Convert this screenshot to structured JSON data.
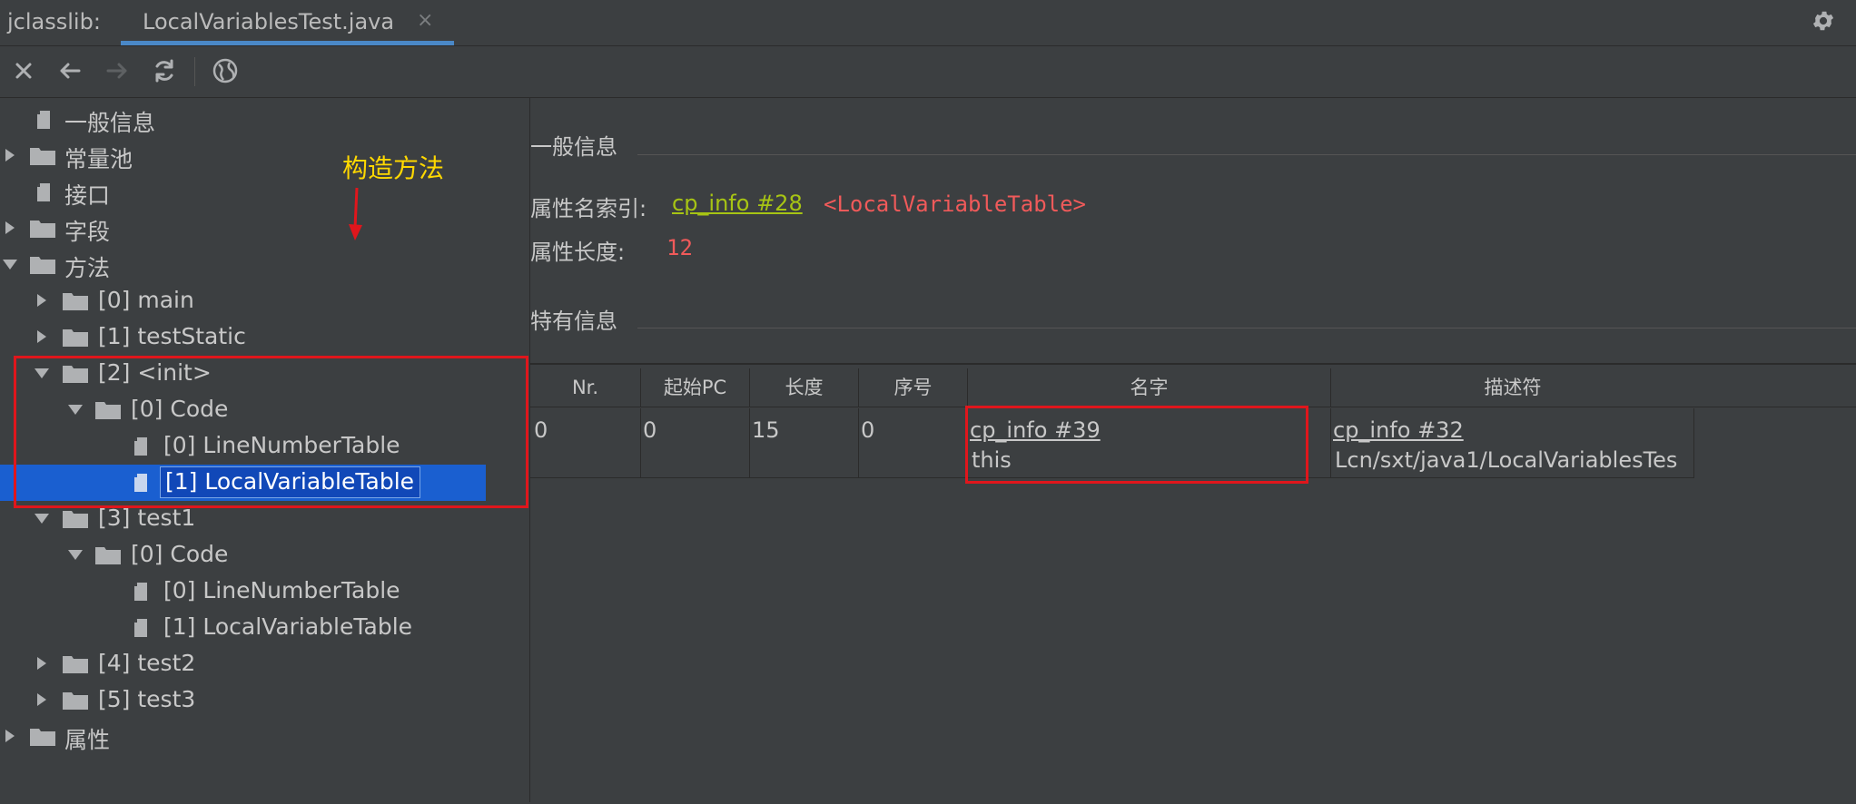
{
  "app": {
    "name": "jclasslib:",
    "file_tab": "LocalVariablesTest.java",
    "close_glyph": "×"
  },
  "toolbar": {
    "icons": [
      "close-icon",
      "back-arrow-icon",
      "forward-arrow-icon",
      "refresh-icon",
      "web-icon"
    ]
  },
  "tree": {
    "nodes": [
      {
        "label": "一般信息"
      },
      {
        "label": "常量池"
      },
      {
        "label": "接口"
      },
      {
        "label": "字段"
      },
      {
        "label": "方法"
      },
      {
        "label": "[0] main"
      },
      {
        "label": "[1] testStatic"
      },
      {
        "label": "[2] <init>"
      },
      {
        "label": "[0] Code"
      },
      {
        "label": "[0] LineNumberTable"
      },
      {
        "label": "[1] LocalVariableTable"
      },
      {
        "label": "[3] test1"
      },
      {
        "label": "[0] Code"
      },
      {
        "label": "[0] LineNumberTable"
      },
      {
        "label": "[1] LocalVariableTable"
      },
      {
        "label": "[4] test2"
      },
      {
        "label": "[5] test3"
      },
      {
        "label": "属性"
      }
    ]
  },
  "annotation": {
    "text": "构造方法",
    "color": "#ffd800",
    "box_color": "#e0161c"
  },
  "detail": {
    "general_title": "一般信息",
    "attr_name_label": "属性名索引:",
    "attr_name_link": "cp_info #28",
    "attr_name_value": "<LocalVariableTable>",
    "attr_len_label": "属性长度:",
    "attr_len_value": "12",
    "specific_title": "特有信息"
  },
  "table": {
    "headers": [
      "Nr.",
      "起始PC",
      "长度",
      "序号",
      "名字",
      "描述符"
    ],
    "rows": [
      {
        "nr": "0",
        "start_pc": "0",
        "length": "15",
        "index": "0",
        "name_link": "cp_info #39",
        "name_value": "this",
        "desc_link": "cp_info #32",
        "desc_value": "Lcn/sxt/java1/LocalVariablesTes"
      }
    ]
  },
  "colors": {
    "link": "#a7c414",
    "value_red": "#f05a5a",
    "selection": "#1a5fd0",
    "tab_underline": "#4a88c7"
  }
}
